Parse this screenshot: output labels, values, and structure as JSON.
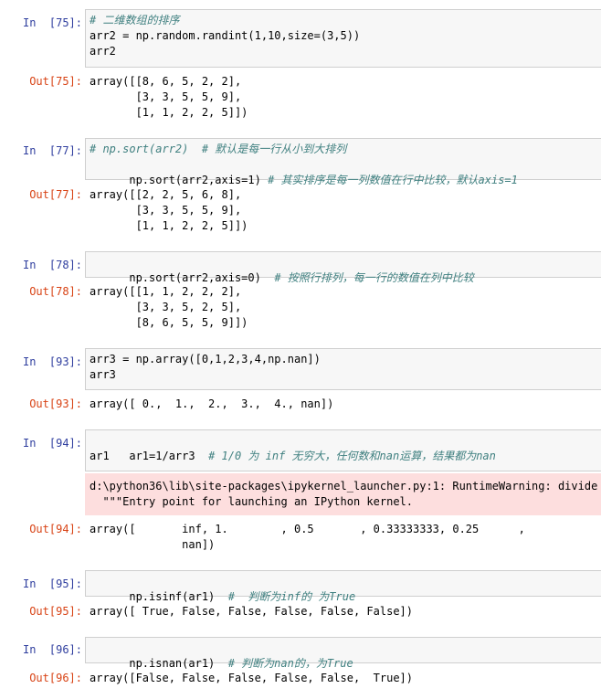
{
  "cells": [
    {
      "in_prompt": "In  [75]:",
      "out_prompt": "Out[75]:",
      "code": [
        "# 二维数组的排序",
        "arr2 = np.random.randint(1,10,size=(3,5))",
        "arr2"
      ],
      "output": [
        "array([[8, 6, 5, 2, 2],",
        "       [3, 3, 5, 5, 9],",
        "       [1, 1, 2, 2, 5]])"
      ]
    },
    {
      "in_prompt": "In  [77]:",
      "out_prompt": "Out[77]:",
      "code": [
        "# np.sort(arr2)  # 默认是每一行从小到大排列",
        "np.sort(arr2,axis=1) # 其实排序是每一列数值在行中比较，默认axis=1"
      ],
      "output": [
        "array([[2, 2, 5, 6, 8],",
        "       [3, 3, 5, 5, 9],",
        "       [1, 1, 2, 2, 5]])"
      ]
    },
    {
      "in_prompt": "In  [78]:",
      "out_prompt": "Out[78]:",
      "code": [
        "np.sort(arr2,axis=0)  # 按照行排列，每一行的数值在列中比较"
      ],
      "output": [
        "array([[1, 1, 2, 2, 2],",
        "       [3, 3, 5, 2, 5],",
        "       [8, 6, 5, 5, 9]])"
      ]
    },
    {
      "in_prompt": "In  [93]:",
      "out_prompt": "Out[93]:",
      "code": [
        "arr3 = np.array([0,1,2,3,4,np.nan])",
        "arr3"
      ],
      "output": [
        "array([ 0.,  1.,  2.,  3.,  4., nan])"
      ]
    },
    {
      "in_prompt": "In  [94]:",
      "out_prompt": "Out[94]:",
      "code": [
        "ar1=1/arr3  # 1/0 为 inf 无穷大，任何数和nan运算，结果都为nan",
        "ar1"
      ],
      "stderr": [
        "d:\\python36\\lib\\site-packages\\ipykernel_launcher.py:1: RuntimeWarning: divide by",
        "  \"\"\"Entry point for launching an IPython kernel."
      ],
      "output": [
        "array([       inf, 1.        , 0.5       , 0.33333333, 0.25      ,",
        "              nan])"
      ]
    },
    {
      "in_prompt": "In  [95]:",
      "out_prompt": "Out[95]:",
      "code": [
        "np.isinf(ar1)  #  判断为inf的 为True"
      ],
      "output": [
        "array([ True, False, False, False, False, False])"
      ]
    },
    {
      "in_prompt": "In  [96]:",
      "out_prompt": "Out[96]:",
      "code": [
        "np.isnan(ar1)  # 判断为nan的，为True"
      ],
      "output": [
        "array([False, False, False, False, False,  True])"
      ]
    }
  ],
  "colors": {
    "in_prompt": "#303f9f",
    "out_prompt": "#d84315",
    "input_bg": "#f7f7f7",
    "input_border": "#cfcfcf",
    "stderr_bg": "#fddede",
    "comment": "#408080"
  }
}
